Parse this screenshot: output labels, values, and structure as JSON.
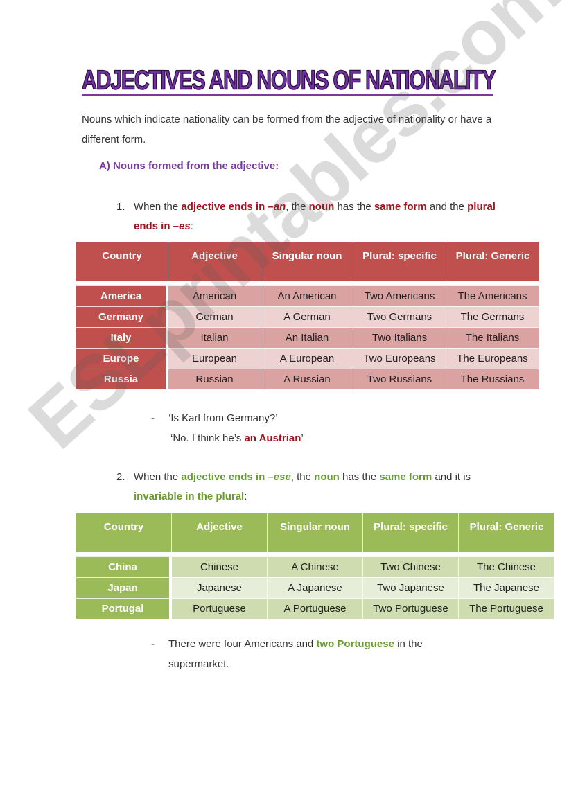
{
  "title": "ADJECTIVES AND NOUNS OF NATIONALITY",
  "intro": "Nouns which indicate nationality can be formed from the adjective of nationality or have a different form.",
  "section_a": "A)  Nouns formed from the adjective:",
  "rule1": {
    "number": "1.",
    "parts": [
      "When the ",
      "adjective ends in –",
      "an",
      ", the ",
      "noun",
      " has the ",
      "same form",
      " and the ",
      "plural ends in –",
      "es",
      ":"
    ]
  },
  "table1": {
    "headers": [
      "Country",
      "Adjective",
      "Singular noun",
      "Plural: specific",
      "Plural: Generic"
    ],
    "rows": [
      [
        "America",
        "American",
        "An American",
        "Two Americans",
        "The Americans"
      ],
      [
        "Germany",
        "German",
        "A German",
        "Two Germans",
        "The Germans"
      ],
      [
        "Italy",
        "Italian",
        "An Italian",
        "Two Italians",
        "The Italians"
      ],
      [
        "Europe",
        "European",
        "A European",
        "Two Europeans",
        "The Europeans"
      ],
      [
        "Russia",
        "Russian",
        "A Russian",
        "Two Russians",
        "The Russians"
      ]
    ],
    "header_color": "#c0504d"
  },
  "example1": {
    "dash": "-",
    "line1": "‘Is Karl from Germany?’",
    "line2_prefix": "‘No. I think he’s ",
    "line2_highlight": "an Austrian",
    "line2_suffix": "’"
  },
  "rule2": {
    "number": "2.",
    "parts": [
      "When the ",
      "adjective ends in –",
      "ese",
      ", the ",
      "noun",
      " has the ",
      "same form",
      " and it is ",
      "invariable in the plural",
      ":"
    ]
  },
  "table2": {
    "headers": [
      "Country",
      "Adjective",
      "Singular noun",
      "Plural: specific",
      "Plural: Generic"
    ],
    "rows": [
      [
        "China",
        "Chinese",
        "A Chinese",
        "Two Chinese",
        "The Chinese"
      ],
      [
        "Japan",
        "Japanese",
        "A Japanese",
        "Two Japanese",
        "The Japanese"
      ],
      [
        "Portugal",
        "Portuguese",
        "A Portuguese",
        "Two Portuguese",
        "The Portuguese"
      ]
    ],
    "header_color": "#9bbb59"
  },
  "example2": {
    "dash": "-",
    "prefix": "There were four Americans and ",
    "highlight": "two Portuguese",
    "suffix": " in the supermarket."
  },
  "colors": {
    "title": "#7030a0",
    "red_accent": "#a0141e",
    "green_accent": "#6a9a30",
    "section": "#7a3a9a"
  },
  "watermark": "ESLprintables.com"
}
